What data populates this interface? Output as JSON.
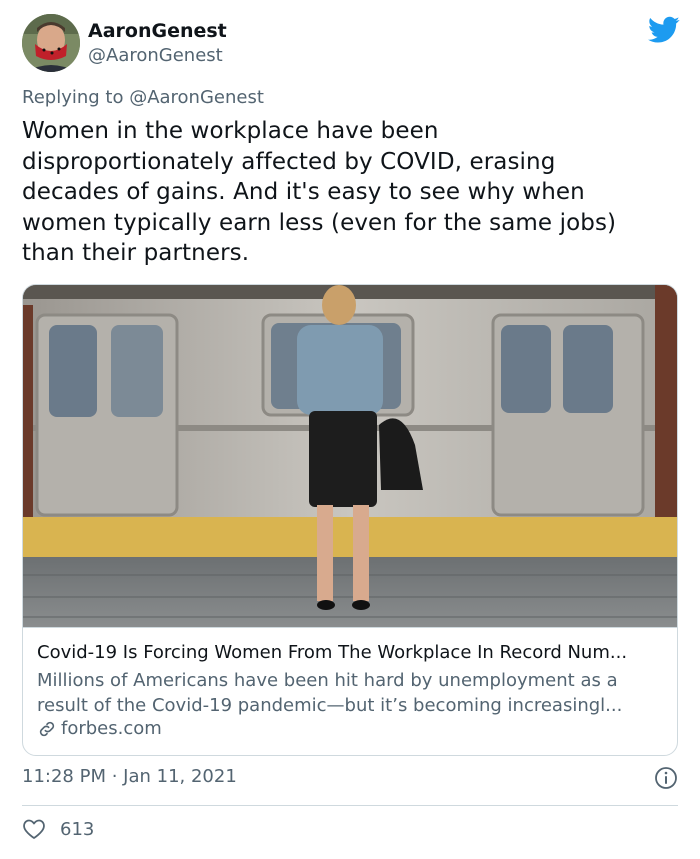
{
  "author": {
    "name": "AaronGenest",
    "handle": "@AaronGenest"
  },
  "reply_to": "Replying to @AaronGenest",
  "tweet": {
    "lines": [
      "Women in the workplace have been",
      "disproportionately affected by COVID, erasing",
      "decades of gains. And it's easy to see why when",
      "women typically earn less (even for the same jobs)",
      "than their partners."
    ]
  },
  "card": {
    "title": "Covid-19 Is Forcing Women From The Workplace In Record Num...",
    "description_lines": [
      "Millions of Americans have been hit hard by unemployment as a",
      "result of the Covid-19 pandemic—but it’s becoming increasingl..."
    ],
    "domain": "forbes.com"
  },
  "timestamp": "11:28 PM · Jan 11, 2021",
  "likes": "613",
  "colors": {
    "twitter_blue": "#1d9bf0",
    "text_primary": "#0f1419",
    "text_secondary": "#536471",
    "border": "#cfd9de"
  },
  "icons": [
    "twitter-bird-icon",
    "link-icon",
    "info-icon",
    "heart-icon"
  ]
}
